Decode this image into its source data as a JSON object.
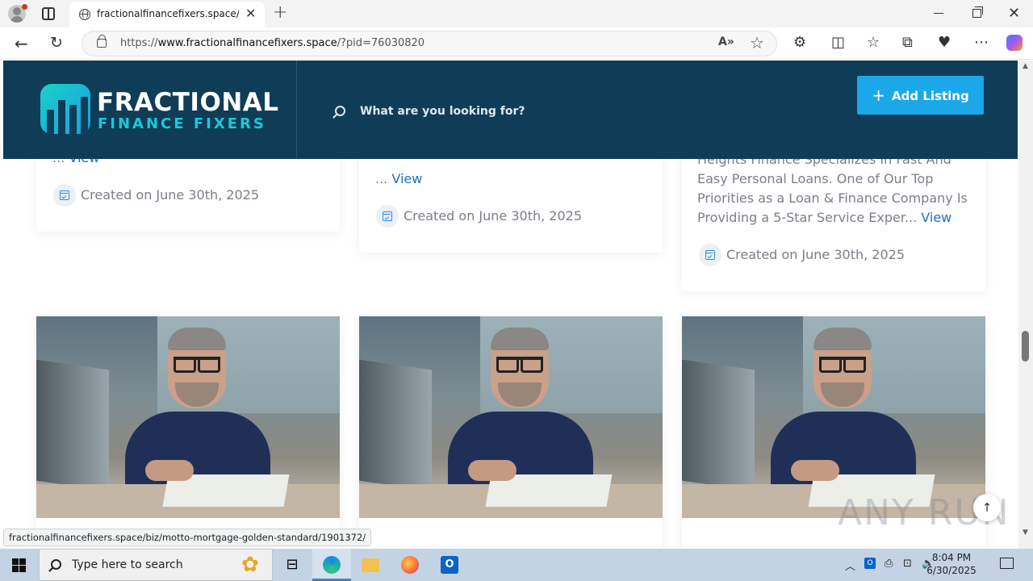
{
  "browser": {
    "tab_title": "fractionalfinancefixers.space/?pid=",
    "tab_close": "✕",
    "new_tab": "+",
    "url_scheme": "https://",
    "url_host": "www.fractionalfinancefixers.space",
    "url_path": "/?pid=76030820",
    "status_url": "fractionalfinancefixers.space/biz/motto-mortgage-golden-standard/1901372/"
  },
  "header": {
    "logo_title": "FRACTIONAL",
    "logo_subtitle": "FINANCE FIXERS",
    "search_placeholder": "What are you looking for?",
    "add_listing_label": "Add Listing"
  },
  "cards_top": [
    {
      "ellipsis": "... ",
      "view_label": "View",
      "created": "Created on June 30th, 2025"
    },
    {
      "ellipsis": "... ",
      "view_label": "View",
      "created": "Created on June 30th, 2025"
    },
    {
      "lines": [
        "Heights Finance Specializes In Fast And",
        "Easy Personal Loans. One of Our Top",
        "Priorities as a Loan & Finance Company Is"
      ],
      "last_line": "Providing a 5-Star Service Exper...",
      "view_label": "View",
      "created": "Created on June 30th, 2025"
    }
  ],
  "watermark": "ANY RUN",
  "scroll_top_glyph": "↑",
  "taskbar": {
    "search_placeholder": "Type here to search",
    "time": "8:04 PM",
    "date": "6/30/2025"
  }
}
